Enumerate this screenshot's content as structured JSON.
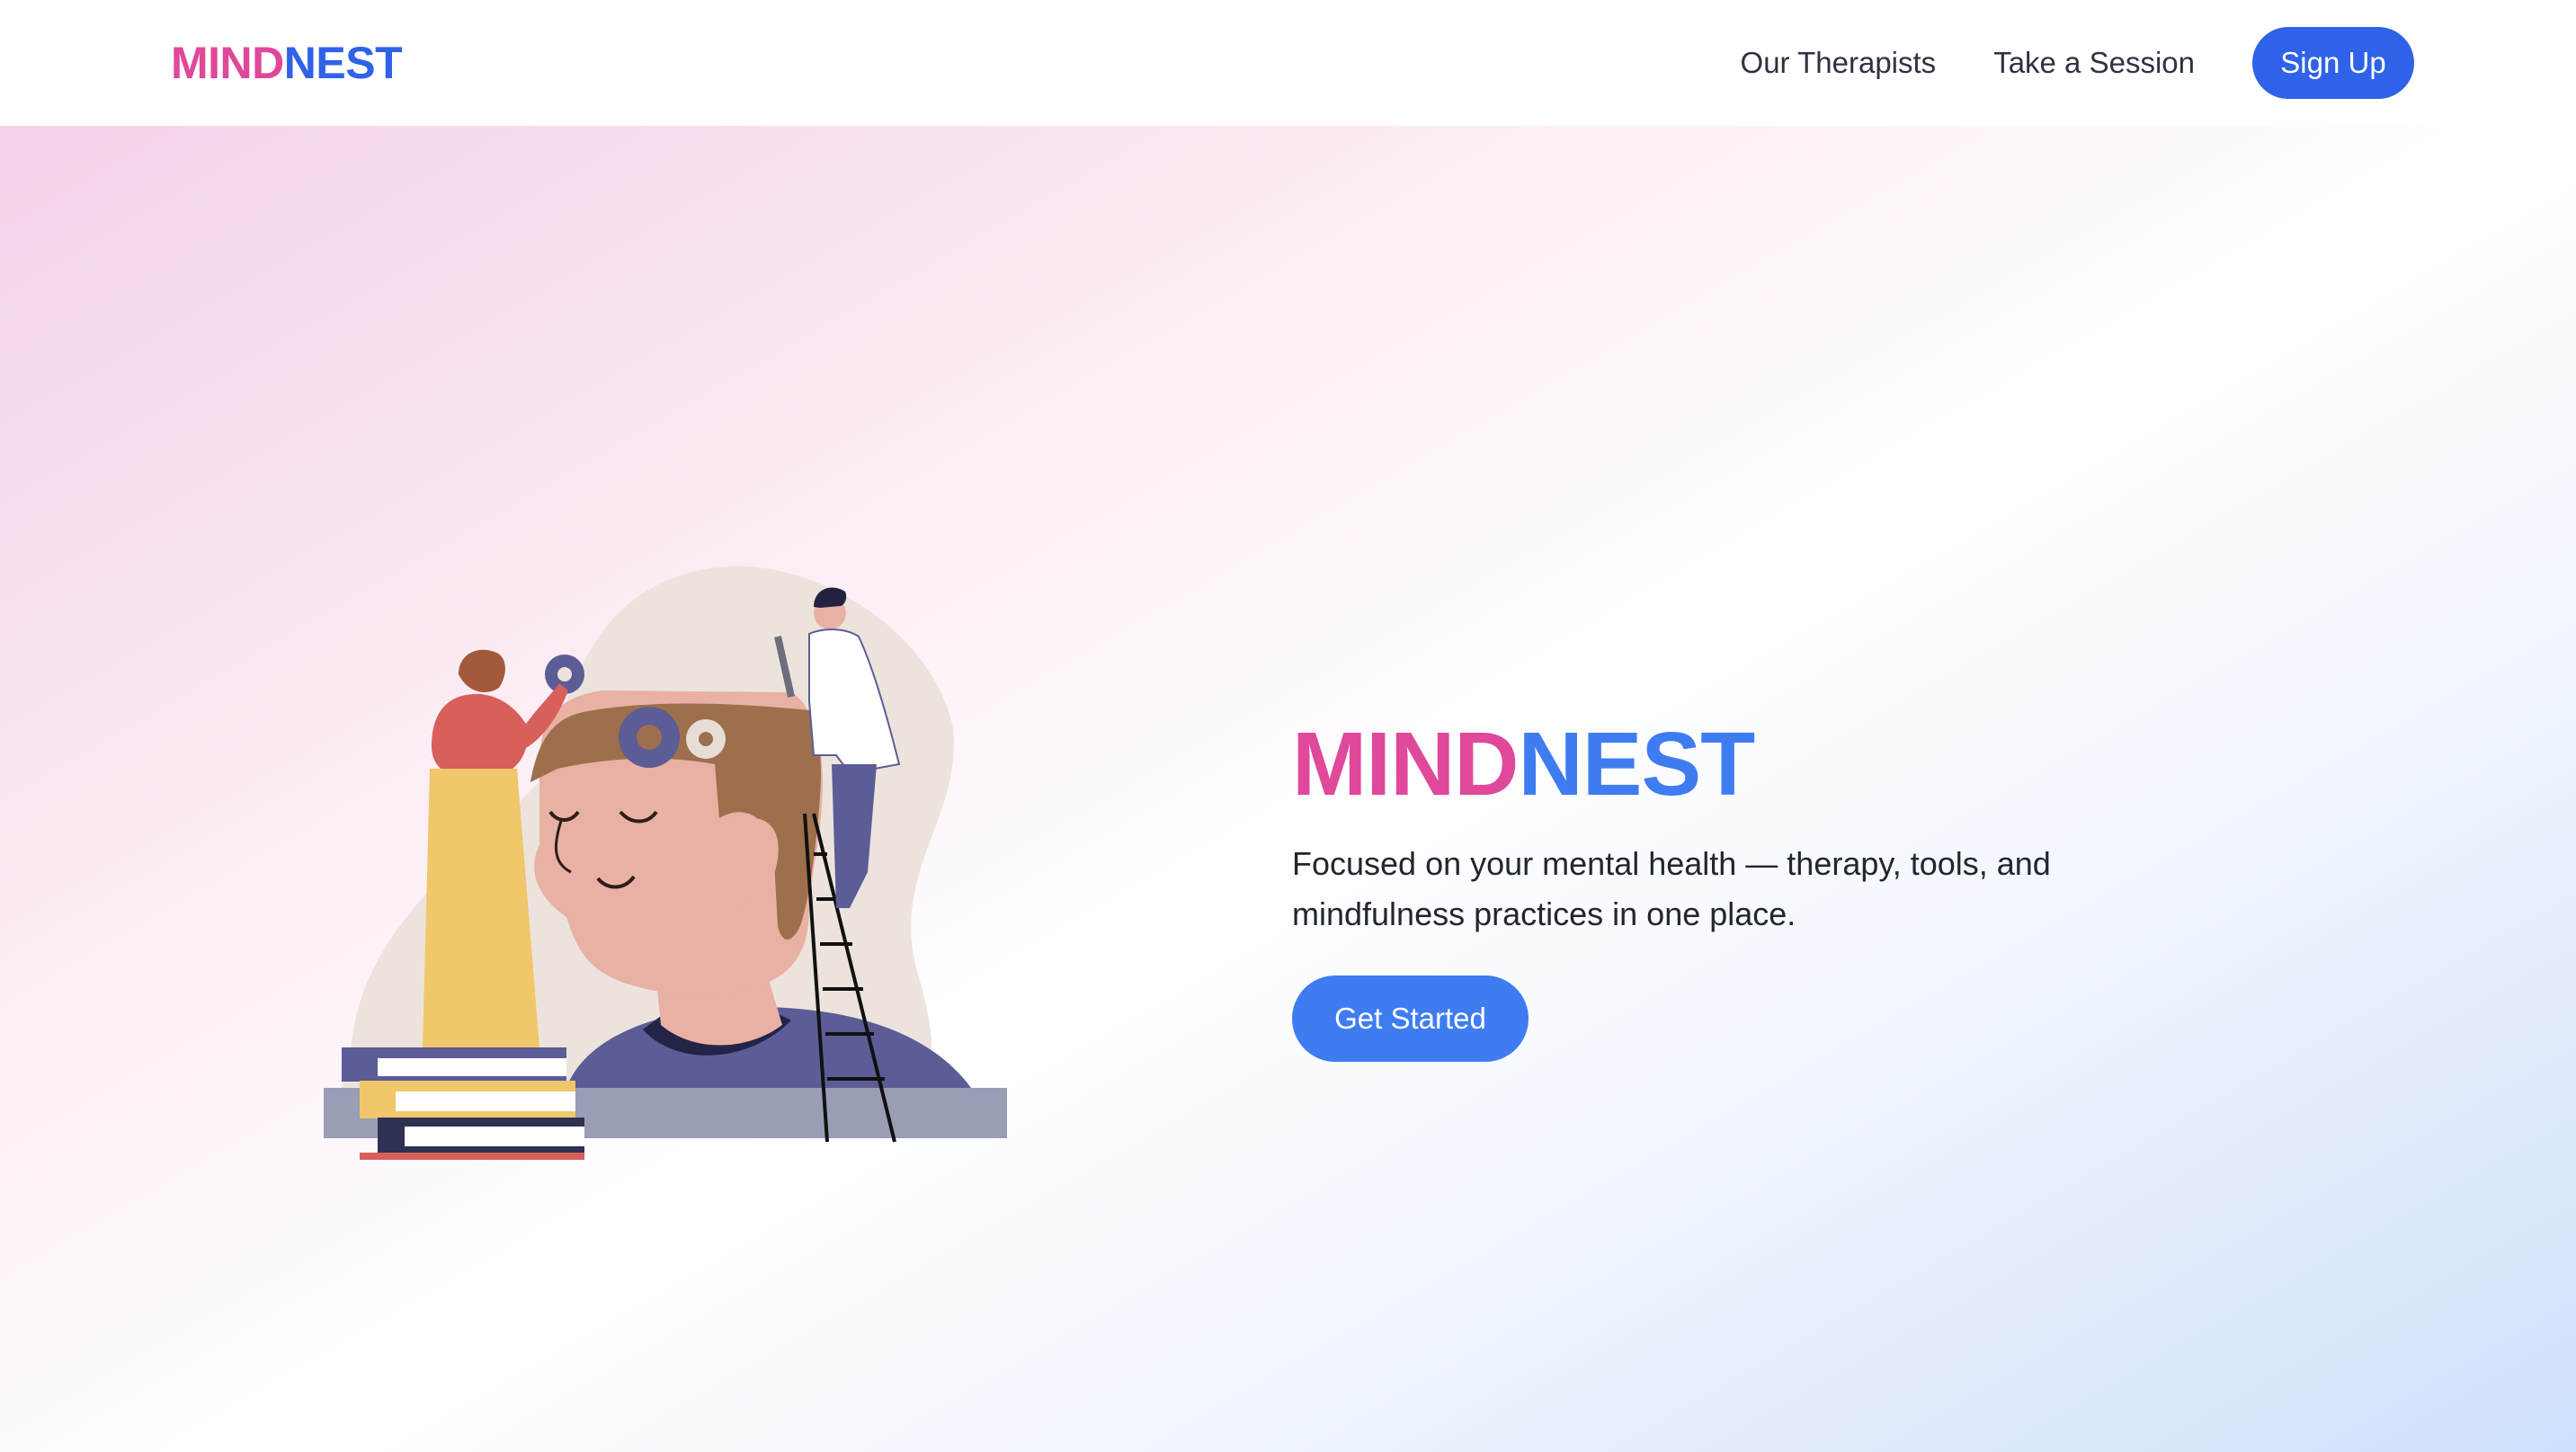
{
  "brand": {
    "part1": "MIND",
    "part2": "NEST"
  },
  "nav": {
    "links": [
      {
        "label": "Our Therapists"
      },
      {
        "label": "Take a Session"
      }
    ],
    "signup_label": "Sign Up"
  },
  "hero": {
    "title_part1": "MIND",
    "title_part2": "NEST",
    "description": "Focused on your mental health — therapy, tools, and mindfulness practices in one place.",
    "cta_label": "Get Started"
  },
  "colors": {
    "brand_pink": "#e0489a",
    "brand_blue": "#2f62e8",
    "cta_blue": "#3f7cf2"
  },
  "icons": [
    "hero-illustration-mind-care"
  ]
}
